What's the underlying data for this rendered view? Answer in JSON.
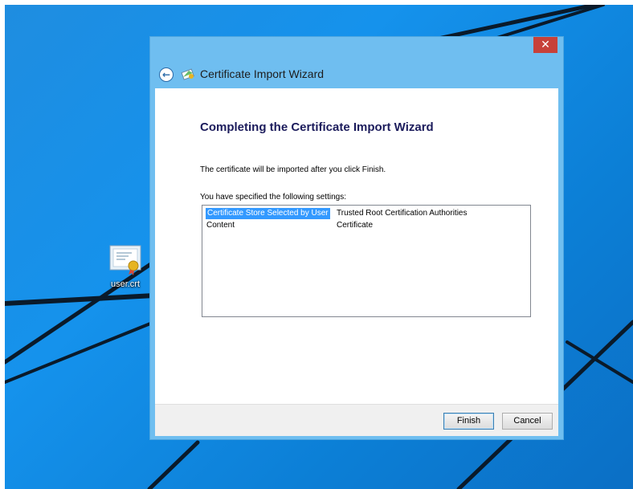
{
  "desktop": {
    "icon": {
      "label": "user.crt",
      "icon": "certificate-file-icon"
    }
  },
  "window": {
    "close_label": "✕",
    "title": "Certificate Import Wizard",
    "back_icon": "back-arrow-icon",
    "wizard_icon": "certificate-wizard-icon",
    "heading": "Completing the Certificate Import Wizard",
    "info_text": "The certificate will be imported after you click Finish.",
    "settings_label": "You have specified the following settings:",
    "settings": [
      {
        "key": "Certificate Store Selected by User",
        "value": "Trusted Root Certification Authorities",
        "selected": true
      },
      {
        "key": "Content",
        "value": "Certificate",
        "selected": false
      }
    ],
    "buttons": {
      "finish": "Finish",
      "cancel": "Cancel"
    }
  },
  "colors": {
    "desktop_blue": "#1592ec",
    "titlebar_blue": "#6fbef0",
    "close_red": "#c7413a",
    "selection_blue": "#3399ff",
    "heading_navy": "#1c1c5c"
  }
}
